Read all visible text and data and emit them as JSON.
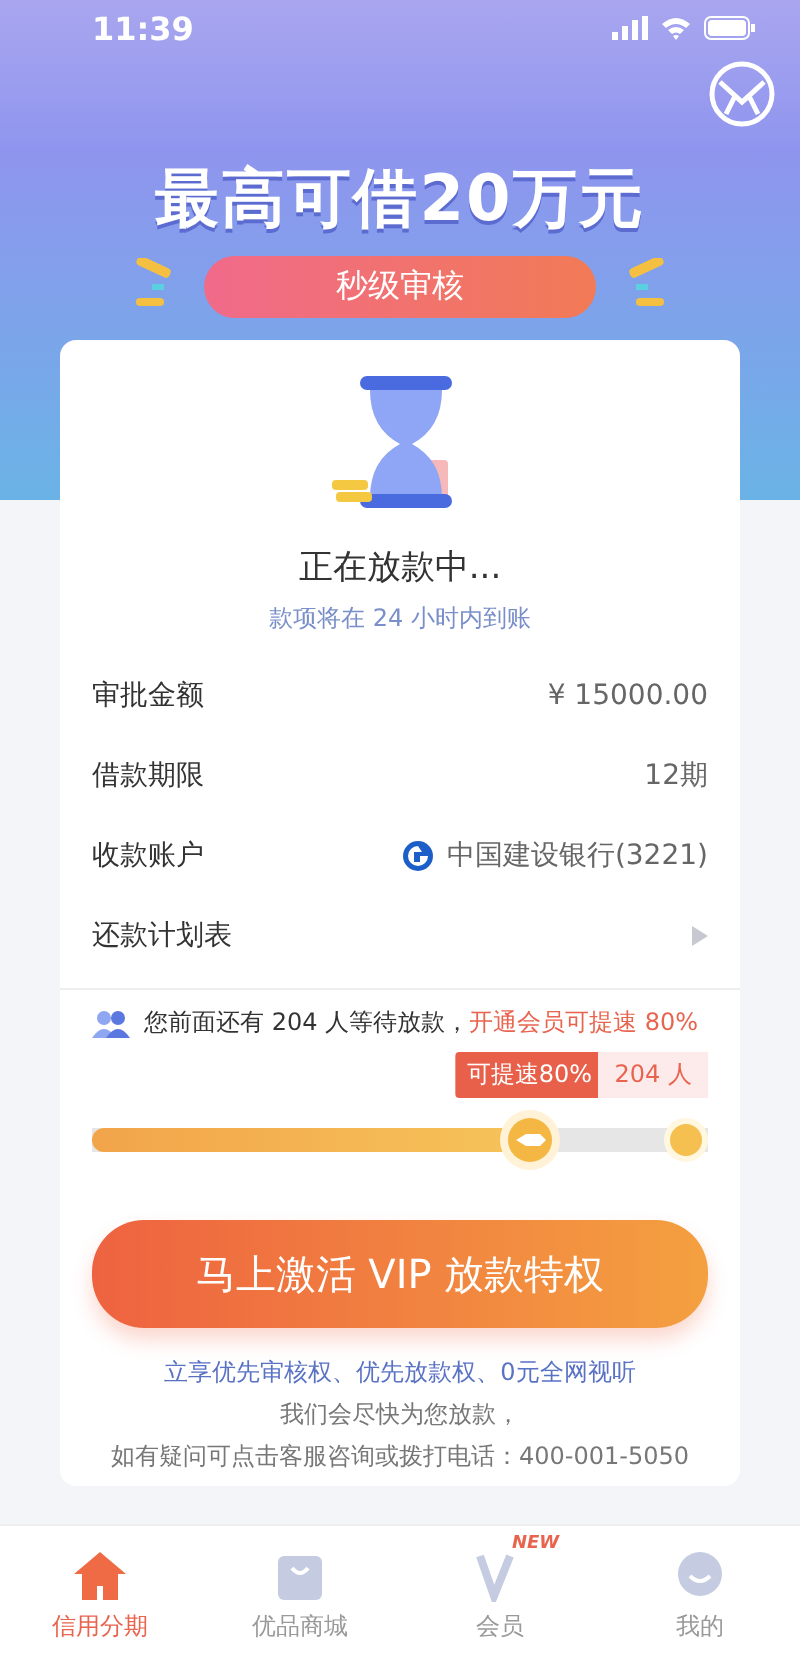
{
  "status_bar": {
    "time": "11:39"
  },
  "banner": {
    "headline": "最高可借20万元",
    "badge": "秒级审核"
  },
  "status": {
    "title": "正在放款中...",
    "subtitle": "款项将在 24 小时内到账"
  },
  "details": [
    {
      "kind": "text",
      "label": "审批金额",
      "value": "¥ 15000.00"
    },
    {
      "kind": "text",
      "label": "借款期限",
      "value": "12期"
    },
    {
      "kind": "bank",
      "label": "收款账户",
      "value": "中国建设银行(3221)"
    },
    {
      "kind": "link",
      "label": "还款计划表"
    }
  ],
  "queue": {
    "message": "您前面还有 204 人等待放款，",
    "highlight": "开通会员可提速 80%",
    "tooltip": "可提速80%",
    "end_label": "204 人",
    "level": 0.71
  },
  "cta": "马上激活 VIP 放款特权",
  "benefits": "立享优先审核权、优先放款权、0元全网视听",
  "notes": [
    "我们会尽快为您放款，",
    "如有疑问可点击客服咨询或拨打电话：400-001-5050"
  ],
  "tabs": [
    {
      "label": "信用分期",
      "selected": true
    },
    {
      "label": "优品商城",
      "selected": false
    },
    {
      "label": "会员",
      "selected": false,
      "badge": "NEW"
    },
    {
      "label": "我的",
      "selected": false
    }
  ]
}
